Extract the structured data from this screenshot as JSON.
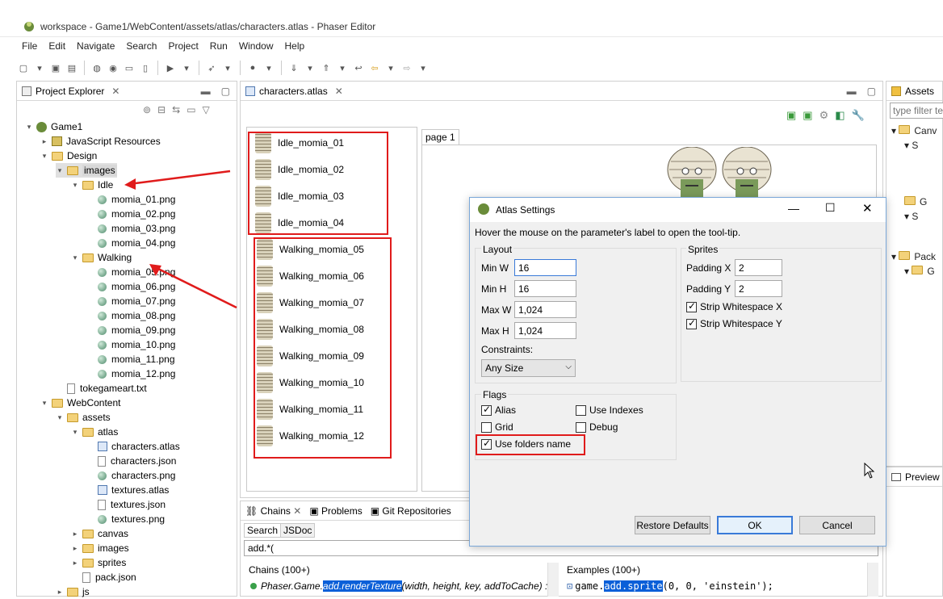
{
  "window": {
    "title": "workspace - Game1/WebContent/assets/atlas/characters.atlas - Phaser Editor"
  },
  "menu": [
    "File",
    "Edit",
    "Navigate",
    "Search",
    "Project",
    "Run",
    "Window",
    "Help"
  ],
  "explorer": {
    "tab": "Project Explorer",
    "tree": [
      {
        "label": "Game1",
        "level": 0,
        "icon": "project-icon",
        "tw": "▾"
      },
      {
        "label": "JavaScript Resources",
        "level": 1,
        "icon": "js-resources-icon",
        "tw": "▸"
      },
      {
        "label": "Design",
        "level": 1,
        "icon": "folder-icon",
        "tw": "▾"
      },
      {
        "label": "images",
        "level": 2,
        "icon": "folder-icon",
        "tw": "▾",
        "selected": true
      },
      {
        "label": "Idle",
        "level": 3,
        "icon": "folder-icon",
        "tw": "▾"
      },
      {
        "label": "momia_01.png",
        "level": 4,
        "icon": "image-file-icon"
      },
      {
        "label": "momia_02.png",
        "level": 4,
        "icon": "image-file-icon"
      },
      {
        "label": "momia_03.png",
        "level": 4,
        "icon": "image-file-icon"
      },
      {
        "label": "momia_04.png",
        "level": 4,
        "icon": "image-file-icon"
      },
      {
        "label": "Walking",
        "level": 3,
        "icon": "folder-icon",
        "tw": "▾"
      },
      {
        "label": "momia_05.png",
        "level": 4,
        "icon": "image-file-icon"
      },
      {
        "label": "momia_06.png",
        "level": 4,
        "icon": "image-file-icon"
      },
      {
        "label": "momia_07.png",
        "level": 4,
        "icon": "image-file-icon"
      },
      {
        "label": "momia_08.png",
        "level": 4,
        "icon": "image-file-icon"
      },
      {
        "label": "momia_09.png",
        "level": 4,
        "icon": "image-file-icon"
      },
      {
        "label": "momia_10.png",
        "level": 4,
        "icon": "image-file-icon"
      },
      {
        "label": "momia_11.png",
        "level": 4,
        "icon": "image-file-icon"
      },
      {
        "label": "momia_12.png",
        "level": 4,
        "icon": "image-file-icon"
      },
      {
        "label": "tokegameart.txt",
        "level": 2,
        "icon": "text-file-icon"
      },
      {
        "label": "WebContent",
        "level": 1,
        "icon": "folder-icon",
        "tw": "▾"
      },
      {
        "label": "assets",
        "level": 2,
        "icon": "folder-icon",
        "tw": "▾"
      },
      {
        "label": "atlas",
        "level": 3,
        "icon": "folder-icon",
        "tw": "▾"
      },
      {
        "label": "characters.atlas",
        "level": 4,
        "icon": "atlas-file-icon"
      },
      {
        "label": "characters.json",
        "level": 4,
        "icon": "text-file-icon"
      },
      {
        "label": "characters.png",
        "level": 4,
        "icon": "image-file-icon"
      },
      {
        "label": "textures.atlas",
        "level": 4,
        "icon": "atlas-file-icon"
      },
      {
        "label": "textures.json",
        "level": 4,
        "icon": "text-file-icon"
      },
      {
        "label": "textures.png",
        "level": 4,
        "icon": "image-file-icon"
      },
      {
        "label": "canvas",
        "level": 3,
        "icon": "folder-icon",
        "tw": "▸"
      },
      {
        "label": "images",
        "level": 3,
        "icon": "folder-icon",
        "tw": "▸"
      },
      {
        "label": "sprites",
        "level": 3,
        "icon": "folder-icon",
        "tw": "▸"
      },
      {
        "label": "pack.json",
        "level": 3,
        "icon": "text-file-icon"
      },
      {
        "label": "js",
        "level": 2,
        "icon": "folder-icon",
        "tw": "▸"
      }
    ]
  },
  "editor": {
    "tab": "characters.atlas",
    "page_tab": "page 1",
    "frames_idle": [
      "Idle_momia_01",
      "Idle_momia_02",
      "Idle_momia_03",
      "Idle_momia_04"
    ],
    "frames_walking": [
      "Walking_momia_05",
      "Walking_momia_06",
      "Walking_momia_07",
      "Walking_momia_08",
      "Walking_momia_09",
      "Walking_momia_10",
      "Walking_momia_11",
      "Walking_momia_12"
    ]
  },
  "assets_panel": {
    "tab": "Assets",
    "filter_placeholder": "type filter te",
    "items": [
      "Canv",
      "S",
      "G",
      "S",
      "Pack",
      "G"
    ]
  },
  "preview_tab": "Preview",
  "bottom": {
    "tabs": [
      "Chains",
      "Problems",
      "Git Repositories"
    ],
    "subtabs": [
      "Search",
      "JSDoc"
    ],
    "query": "add.*(",
    "chains_header": "Chains (100+)",
    "chain_line_prefix": "Phaser.Game.",
    "chain_line_highlight": "add.renderTexture",
    "chain_line_suffix": "(width, height, key, addToCache) : ",
    "examples_header": "Examples (100+)",
    "example_prefix": "game.",
    "example_highlight": "add.sprite",
    "example_suffix": "(0, 0, 'einstein');"
  },
  "dialog": {
    "title": "Atlas Settings",
    "hint": "Hover the mouse on the parameter's label to open the tool-tip.",
    "layout_label": "Layout",
    "min_w_label": "Min W",
    "min_w": "16",
    "min_h_label": "Min H",
    "min_h": "16",
    "max_w_label": "Max W",
    "max_w": "1,024",
    "max_h_label": "Max H",
    "max_h": "1,024",
    "constraints_label": "Constraints:",
    "constraints_value": "Any Size",
    "sprites_label": "Sprites",
    "padding_x_label": "Padding X",
    "padding_x": "2",
    "padding_y_label": "Padding Y",
    "padding_y": "2",
    "strip_x": "Strip Whitespace X",
    "strip_y": "Strip Whitespace Y",
    "flags_label": "Flags",
    "alias": "Alias",
    "use_indexes": "Use Indexes",
    "grid": "Grid",
    "debug": "Debug",
    "use_folders_name": "Use folders name",
    "restore_defaults": "Restore Defaults",
    "ok": "OK",
    "cancel": "Cancel"
  },
  "colors": {
    "highlight": "#e01b1b",
    "selection": "#0a5fd8"
  }
}
